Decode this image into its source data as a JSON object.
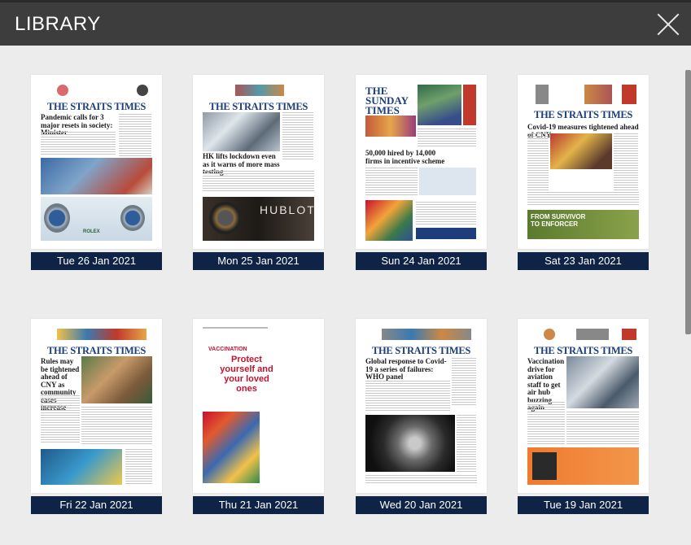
{
  "header": {
    "title": "LIBRARY"
  },
  "editions": [
    {
      "date": "Tue 26 Jan 2021",
      "masthead": "THE STRAITS TIMES",
      "headline": "Pandemic calls for 3 major resets in society: Minister",
      "ad_text": "ROLEX"
    },
    {
      "date": "Mon 25 Jan 2021",
      "masthead": "THE STRAITS TIMES",
      "headline": "HK lifts lockdown even as it warns of more mass testing",
      "ad_text": "HUBLOT"
    },
    {
      "date": "Sun 24 Jan 2021",
      "masthead": "THE SUNDAY TIMES",
      "headline": "50,000 hired by 14,000 firms in incentive scheme"
    },
    {
      "date": "Sat 23 Jan 2021",
      "masthead": "THE STRAITS TIMES",
      "headline": "Covid-19 measures tightened ahead of CNY",
      "banner": "FROM SURVIVOR TO ENFORCER"
    },
    {
      "date": "Fri 22 Jan 2021",
      "masthead": "THE STRAITS TIMES",
      "headline": "Rules may be tightened ahead of CNY as community cases increase"
    },
    {
      "date": "Thu 21 Jan 2021",
      "vacc_brand": "VACCINATION",
      "vacc_text": "Protect yourself and your loved ones"
    },
    {
      "date": "Wed 20 Jan 2021",
      "masthead": "THE STRAITS TIMES",
      "headline": "Global response to Covid-19 a series of failures: WHO panel"
    },
    {
      "date": "Tue 19 Jan 2021",
      "masthead": "THE STRAITS TIMES",
      "headline": "Vaccination drive for aviation staff to get air hub buzzing again"
    }
  ]
}
